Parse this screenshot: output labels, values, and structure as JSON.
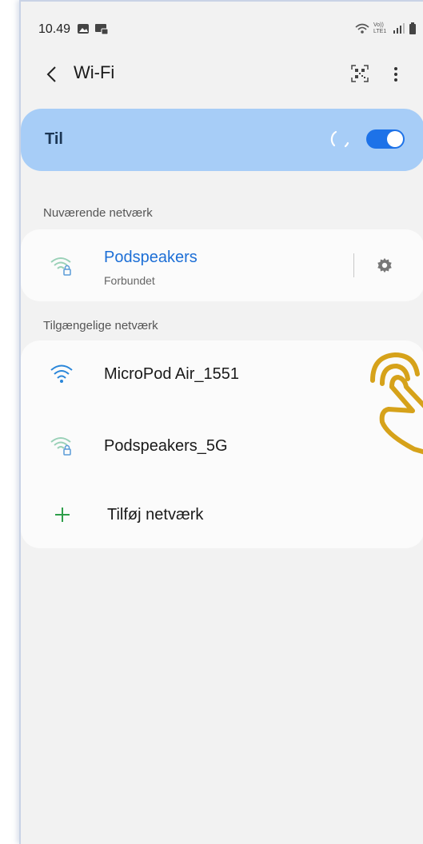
{
  "status_bar": {
    "time": "10.49",
    "left_icons": [
      "gallery-icon",
      "screen-cast-icon"
    ],
    "right_icons": [
      "wifi-calling-icon",
      "volte-lte-icon",
      "signal-icon",
      "battery-icon"
    ],
    "volte_text": "Vo)) LTE1"
  },
  "app_bar": {
    "title": "Wi-Fi",
    "back_icon": "chevron-left-icon",
    "qr_icon": "qr-code-icon",
    "more_icon": "more-vert-icon"
  },
  "toggle": {
    "label": "Til",
    "state": "on",
    "accent_color": "#1d72e8",
    "card_color": "#a7cdf7"
  },
  "current_network": {
    "header": "Nuværende netværk",
    "name": "Podspeakers",
    "status": "Forbundet",
    "icon": "wifi-locked-icon",
    "settings_icon": "gear-icon"
  },
  "available_networks": {
    "header": "Tilgængelige netværk",
    "items": [
      {
        "name": "MicroPod Air_1551",
        "icon": "wifi-open-icon"
      },
      {
        "name": "Podspeakers_5G",
        "icon": "wifi-locked-icon"
      }
    ],
    "add_network_label": "Tilføj netværk",
    "add_icon": "plus-icon"
  },
  "overlay": {
    "icon": "tap-hand-icon",
    "color": "#d6a21a"
  }
}
